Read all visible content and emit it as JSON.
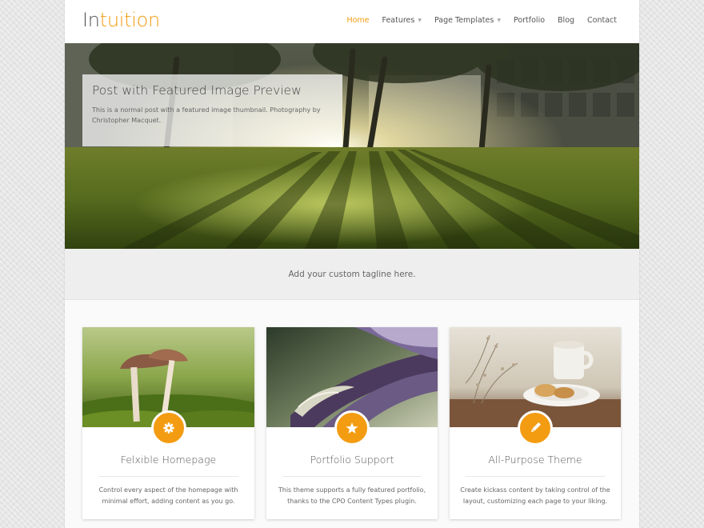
{
  "brand": {
    "part1": "In",
    "part2": "tuition",
    "accent": "#f39c12"
  },
  "nav": {
    "items": [
      {
        "label": "Home"
      },
      {
        "label": "Features"
      },
      {
        "label": "Page Templates"
      },
      {
        "label": "Portfolio"
      },
      {
        "label": "Blog"
      },
      {
        "label": "Contact"
      }
    ]
  },
  "hero": {
    "title": "Post with Featured Image Preview",
    "description": "This is a normal post with a featured image thumbnail. Photography by Christopher Macquet."
  },
  "tagline": "Add your custom tagline here.",
  "features": [
    {
      "icon": "gear-icon",
      "title": "Felxible Homepage",
      "text": "Control every aspect of the homepage with minimal effort, adding content as you go."
    },
    {
      "icon": "star-icon",
      "title": "Portfolio Support",
      "text": "This theme supports a fully featured portfolio, thanks to the CPO Content Types plugin."
    },
    {
      "icon": "pencil-icon",
      "title": "All-Purpose Theme",
      "text": "Create kickass content by taking control of the layout, customizing each page to your liking."
    }
  ]
}
